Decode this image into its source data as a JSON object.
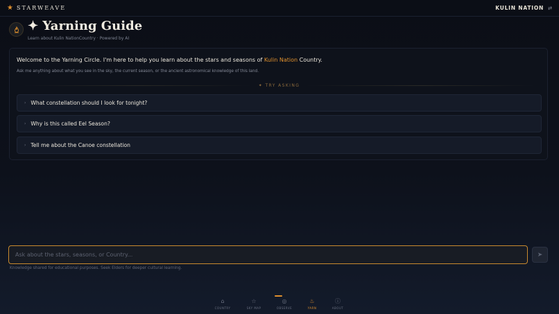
{
  "app": {
    "brand": "STARWEAVE",
    "nation": "KULIN NATION"
  },
  "header": {
    "title": "✦ Yarning Guide",
    "subtitle": "Learn about Kulin NationCountry · Powered by AI"
  },
  "welcome": {
    "text_before": "Welcome to the Yarning Circle. I'm here to help you learn about the stars and seasons of ",
    "nation_link": "Kulin Nation",
    "text_after": " Country.",
    "helper": "Ask me anything about what you see in the sky, the current season, or the ancient astronomical knowledge of this land."
  },
  "try_asking": {
    "label": "✦ TRY ASKING",
    "suggestions": [
      "What constellation should I look for tonight?",
      "Why is this called Eel Season?",
      "Tell me about the Canoe constellation"
    ]
  },
  "chat_input": {
    "placeholder": "Ask about the stars, seasons, or Country...",
    "value": ""
  },
  "disclaimer": "Knowledge shared for educational purposes. Seek Elders for deeper cultural learning.",
  "bottom_nav": {
    "items": [
      {
        "label": "COUNTRY",
        "icon": "home-icon"
      },
      {
        "label": "SKY MAP",
        "icon": "star-icon"
      },
      {
        "label": "OBSERVE",
        "icon": "telescope-icon"
      },
      {
        "label": "YARN",
        "icon": "campfire-icon"
      },
      {
        "label": "ABOUT",
        "icon": "info-icon"
      }
    ],
    "active": "YARN"
  },
  "colors": {
    "accent": "#e0902d",
    "background": "#0c0f18"
  }
}
